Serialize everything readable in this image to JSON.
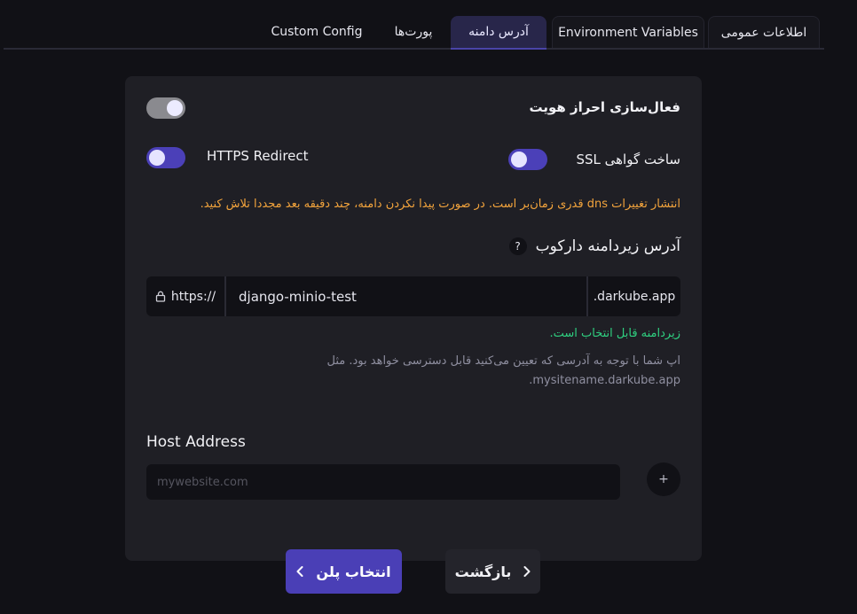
{
  "tabs": [
    {
      "label": "اطلاعات عمومی",
      "state": "bordered"
    },
    {
      "label": "Environment Variables",
      "state": "bordered"
    },
    {
      "label": "آدرس دامنه",
      "state": "active"
    },
    {
      "label": "پورت‌ها",
      "state": "normal"
    },
    {
      "label": "Custom Config",
      "state": "normal"
    }
  ],
  "auth": {
    "label": "فعال‌سازی احراز هویت",
    "enabled": false
  },
  "ssl": {
    "label": "ساخت گواهی SSL",
    "enabled": true
  },
  "https_redirect": {
    "label": "HTTPS Redirect",
    "enabled": true
  },
  "dns_warning": "انتشار تغییرات dns قدری زمان‌بر است. در صورت پیدا نکردن دامنه، چند دقیقه بعد مجددا تلاش کنید.",
  "subdomain": {
    "title": "آدرس زیردامنه دارکوب",
    "help_icon": "?",
    "prefix": "https://",
    "value": "django-minio-test",
    "suffix": ".darkube.app",
    "status": "زیردامنه قابل انتخاب است.",
    "hint_line1": "اپ شما با توجه به آدرسی که تعیین می‌کنید قابل دسترسی خواهد بود. مثل",
    "hint_line2": ".mysitename.darkube.app"
  },
  "host": {
    "title": "Host Address",
    "placeholder": "mywebsite.com",
    "add_label": "+"
  },
  "buttons": {
    "next": "انتخاب پلن",
    "back": "بازگشت"
  },
  "colors": {
    "accent": "#4a3fb6",
    "warning": "#f3a43c",
    "success": "#2fd080"
  }
}
